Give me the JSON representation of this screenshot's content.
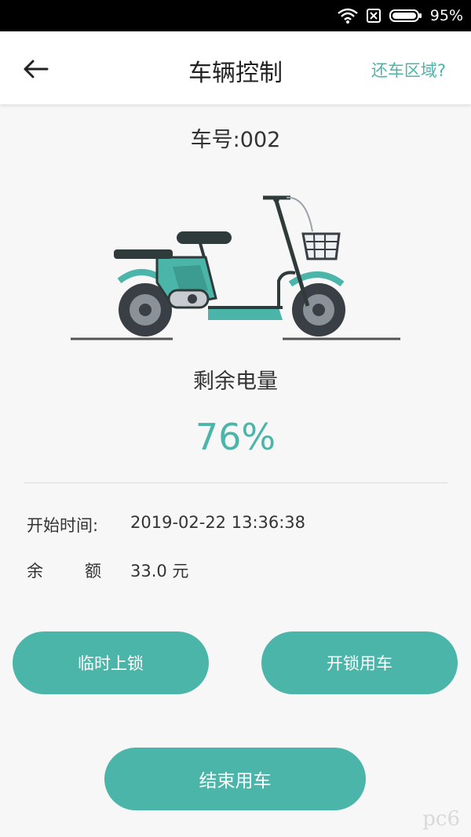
{
  "status_bar": {
    "battery_percent": "95%"
  },
  "header": {
    "title": "车辆控制",
    "back_icon": "arrow-left-icon",
    "area_link": "还车区域?"
  },
  "vehicle": {
    "number_label": "车号:002"
  },
  "battery": {
    "label": "剩余电量",
    "value": "76%"
  },
  "info": {
    "start_time_label": "开始时间:",
    "start_time_value": "2019-02-22 13:36:38",
    "balance_label_a": "余",
    "balance_label_b": "额",
    "balance_value": "33.0 元"
  },
  "actions": {
    "temp_lock": "临时上锁",
    "unlock": "开锁用车",
    "end_ride": "结束用车"
  },
  "watermark": "pc6",
  "colors": {
    "accent": "#4bb5a9"
  }
}
